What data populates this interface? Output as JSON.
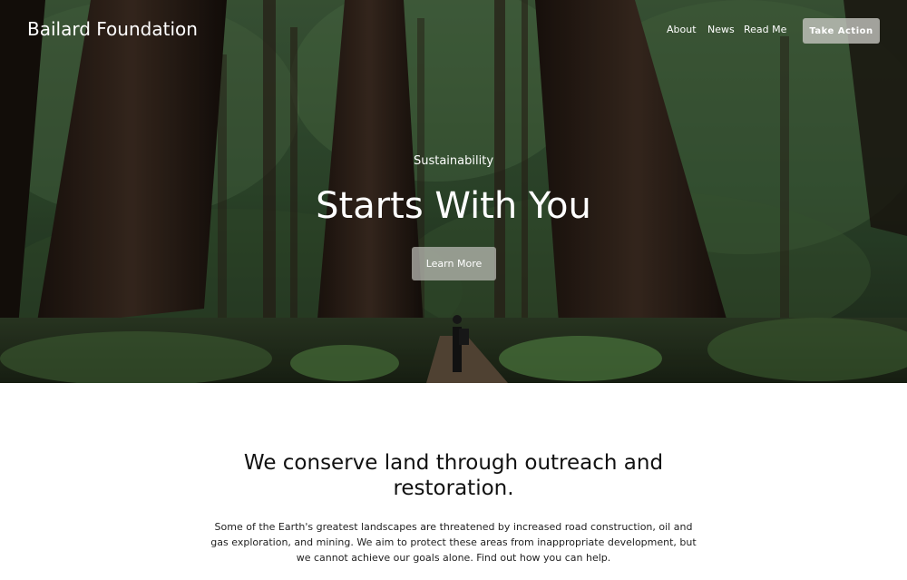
{
  "header": {
    "site_title": "Bailard Foundation",
    "nav": [
      {
        "label": "About"
      },
      {
        "label": "News"
      },
      {
        "label": "Read Me"
      }
    ],
    "cta_label": "Take Action"
  },
  "hero": {
    "kicker": "Sustainability",
    "title": "Starts With You",
    "button_label": "Learn More",
    "image_subject": "redwood forest with hiker on trail"
  },
  "section": {
    "heading": "We conserve land through outreach and restoration.",
    "body": "Some of the Earth's greatest landscapes are threatened by increased road construction, oil and gas exploration, and mining. We aim to protect these areas from inappropriate development, but we cannot achieve our goals alone. Find out how you can help."
  },
  "colors": {
    "hero_overlay_text": "#ffffff",
    "button_bg": "#c2c2bd",
    "page_bg": "#ffffff",
    "text_dark": "#111111"
  }
}
